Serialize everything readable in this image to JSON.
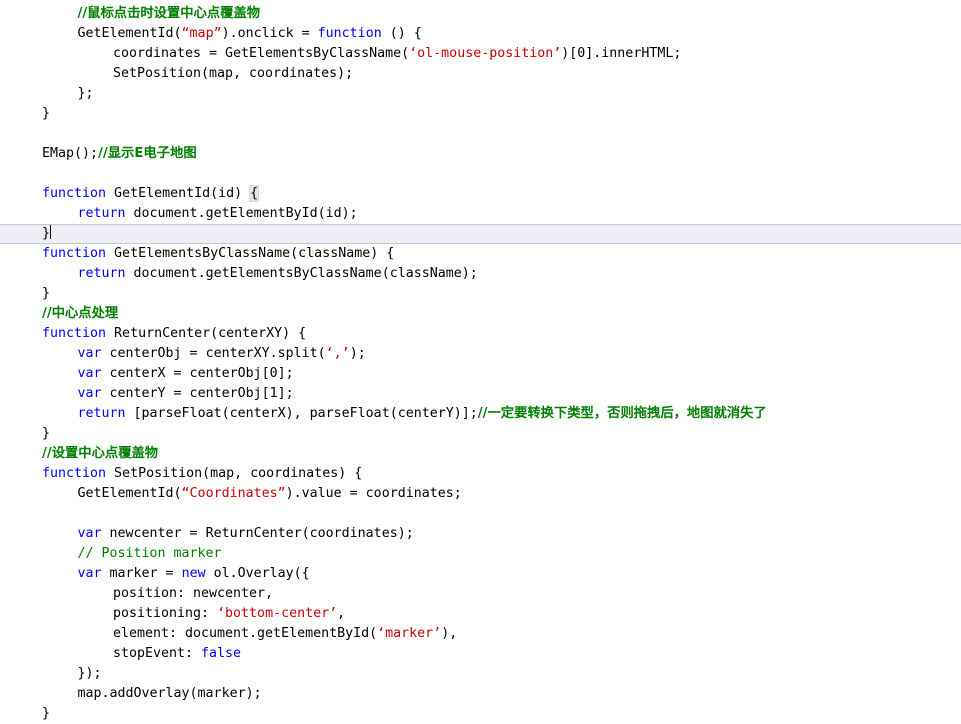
{
  "editor": {
    "background": "#ffffff",
    "foreground": "#000000",
    "keyword_color": "#0000ff",
    "string_color": "#cc0000",
    "comment_color": "#008000",
    "current_line_bg": "#eeeef6",
    "current_line_border": "#c8c8d4",
    "brace_match_bg": "#e6e6dc",
    "language": "JavaScript",
    "cursor_line_number": 12
  },
  "lines": [
    {
      "n": 1,
      "indent": 4,
      "tokens": [
        {
          "t": "//鼠标点击时设置中心点覆盖物",
          "c": "cmt",
          "cjk": true
        }
      ]
    },
    {
      "n": 2,
      "indent": 4,
      "tokens": [
        {
          "t": "GetElementId(",
          "c": "plain"
        },
        {
          "t": "“map”",
          "c": "str"
        },
        {
          "t": ").onclick = ",
          "c": "plain"
        },
        {
          "t": "function",
          "c": "kw"
        },
        {
          "t": " () {",
          "c": "plain"
        }
      ]
    },
    {
      "n": 3,
      "indent": 8,
      "tokens": [
        {
          "t": "coordinates = GetElementsByClassName(",
          "c": "plain"
        },
        {
          "t": "‘ol-mouse-position’",
          "c": "str"
        },
        {
          "t": ")[0].innerHTML;",
          "c": "plain"
        }
      ]
    },
    {
      "n": 4,
      "indent": 8,
      "tokens": [
        {
          "t": "SetPosition(map, coordinates);",
          "c": "plain"
        }
      ]
    },
    {
      "n": 5,
      "indent": 4,
      "tokens": [
        {
          "t": "};",
          "c": "plain"
        }
      ]
    },
    {
      "n": 6,
      "indent": 0,
      "tokens": [
        {
          "t": "}",
          "c": "plain"
        }
      ]
    },
    {
      "n": 7,
      "indent": 0,
      "tokens": []
    },
    {
      "n": 8,
      "indent": 0,
      "tokens": [
        {
          "t": "EMap();",
          "c": "plain"
        },
        {
          "t": "//显示E电子地图",
          "c": "cmt",
          "cjk": true
        }
      ]
    },
    {
      "n": 9,
      "indent": 0,
      "tokens": []
    },
    {
      "n": 10,
      "indent": 0,
      "tokens": [
        {
          "t": "function",
          "c": "kw"
        },
        {
          "t": " GetElementId(id) ",
          "c": "plain"
        },
        {
          "t": "{",
          "c": "plain",
          "brace_match": true
        }
      ]
    },
    {
      "n": 11,
      "indent": 4,
      "tokens": [
        {
          "t": "return",
          "c": "kw"
        },
        {
          "t": " document.getElementById(id);",
          "c": "plain"
        }
      ]
    },
    {
      "n": 12,
      "indent": 0,
      "current": true,
      "tokens": [
        {
          "t": "}",
          "c": "plain"
        },
        {
          "t": "",
          "c": "plain",
          "caret": true
        }
      ]
    },
    {
      "n": 13,
      "indent": 0,
      "tokens": [
        {
          "t": "function",
          "c": "kw"
        },
        {
          "t": " GetElementsByClassName(className) {",
          "c": "plain"
        }
      ]
    },
    {
      "n": 14,
      "indent": 4,
      "tokens": [
        {
          "t": "return",
          "c": "kw"
        },
        {
          "t": " document.getElementsByClassName(className);",
          "c": "plain"
        }
      ]
    },
    {
      "n": 15,
      "indent": 0,
      "tokens": [
        {
          "t": "}",
          "c": "plain"
        }
      ]
    },
    {
      "n": 16,
      "indent": 0,
      "tokens": [
        {
          "t": "//中心点处理",
          "c": "cmt",
          "cjk": true
        }
      ]
    },
    {
      "n": 17,
      "indent": 0,
      "tokens": [
        {
          "t": "function",
          "c": "kw"
        },
        {
          "t": " ReturnCenter(centerXY) {",
          "c": "plain"
        }
      ]
    },
    {
      "n": 18,
      "indent": 4,
      "tokens": [
        {
          "t": "var",
          "c": "kw"
        },
        {
          "t": " centerObj = centerXY.split(",
          "c": "plain"
        },
        {
          "t": "‘,’",
          "c": "str"
        },
        {
          "t": ");",
          "c": "plain"
        }
      ]
    },
    {
      "n": 19,
      "indent": 4,
      "tokens": [
        {
          "t": "var",
          "c": "kw"
        },
        {
          "t": " centerX = centerObj[0];",
          "c": "plain"
        }
      ]
    },
    {
      "n": 20,
      "indent": 4,
      "tokens": [
        {
          "t": "var",
          "c": "kw"
        },
        {
          "t": " centerY = centerObj[1];",
          "c": "plain"
        }
      ]
    },
    {
      "n": 21,
      "indent": 4,
      "tokens": [
        {
          "t": "return",
          "c": "kw"
        },
        {
          "t": " [parseFloat(centerX), parseFloat(centerY)];",
          "c": "plain"
        },
        {
          "t": "//一定要转换下类型，否则拖拽后，地图就消失了",
          "c": "cmt",
          "cjk": true
        }
      ]
    },
    {
      "n": 22,
      "indent": 0,
      "tokens": [
        {
          "t": "}",
          "c": "plain"
        }
      ]
    },
    {
      "n": 23,
      "indent": 0,
      "tokens": [
        {
          "t": "//设置中心点覆盖物",
          "c": "cmt",
          "cjk": true
        }
      ]
    },
    {
      "n": 24,
      "indent": 0,
      "tokens": [
        {
          "t": "function",
          "c": "kw"
        },
        {
          "t": " SetPosition(map, coordinates) {",
          "c": "plain"
        }
      ]
    },
    {
      "n": 25,
      "indent": 4,
      "tokens": [
        {
          "t": "GetElementId(",
          "c": "plain"
        },
        {
          "t": "“Coordinates”",
          "c": "str"
        },
        {
          "t": ").value = coordinates;",
          "c": "plain"
        }
      ]
    },
    {
      "n": 26,
      "indent": 0,
      "tokens": []
    },
    {
      "n": 27,
      "indent": 4,
      "tokens": [
        {
          "t": "var",
          "c": "kw"
        },
        {
          "t": " newcenter = ReturnCenter(coordinates);",
          "c": "plain"
        }
      ]
    },
    {
      "n": 28,
      "indent": 4,
      "tokens": [
        {
          "t": "// Position marker",
          "c": "cmt"
        }
      ]
    },
    {
      "n": 29,
      "indent": 4,
      "tokens": [
        {
          "t": "var",
          "c": "kw"
        },
        {
          "t": " marker = ",
          "c": "plain"
        },
        {
          "t": "new",
          "c": "kw"
        },
        {
          "t": " ol.Overlay({",
          "c": "plain"
        }
      ]
    },
    {
      "n": 30,
      "indent": 8,
      "tokens": [
        {
          "t": "position: newcenter,",
          "c": "plain"
        }
      ]
    },
    {
      "n": 31,
      "indent": 8,
      "tokens": [
        {
          "t": "positioning: ",
          "c": "plain"
        },
        {
          "t": "‘bottom-center’",
          "c": "str"
        },
        {
          "t": ",",
          "c": "plain"
        }
      ]
    },
    {
      "n": 32,
      "indent": 8,
      "tokens": [
        {
          "t": "element: document.getElementById(",
          "c": "plain"
        },
        {
          "t": "‘marker’",
          "c": "str"
        },
        {
          "t": "),",
          "c": "plain"
        }
      ]
    },
    {
      "n": 33,
      "indent": 8,
      "tokens": [
        {
          "t": "stopEvent: ",
          "c": "plain"
        },
        {
          "t": "false",
          "c": "kw"
        }
      ]
    },
    {
      "n": 34,
      "indent": 4,
      "tokens": [
        {
          "t": "});",
          "c": "plain"
        }
      ]
    },
    {
      "n": 35,
      "indent": 4,
      "tokens": [
        {
          "t": "map.addOverlay(marker);",
          "c": "plain"
        }
      ]
    },
    {
      "n": 36,
      "indent": 0,
      "tokens": [
        {
          "t": "}",
          "c": "plain"
        }
      ]
    }
  ]
}
